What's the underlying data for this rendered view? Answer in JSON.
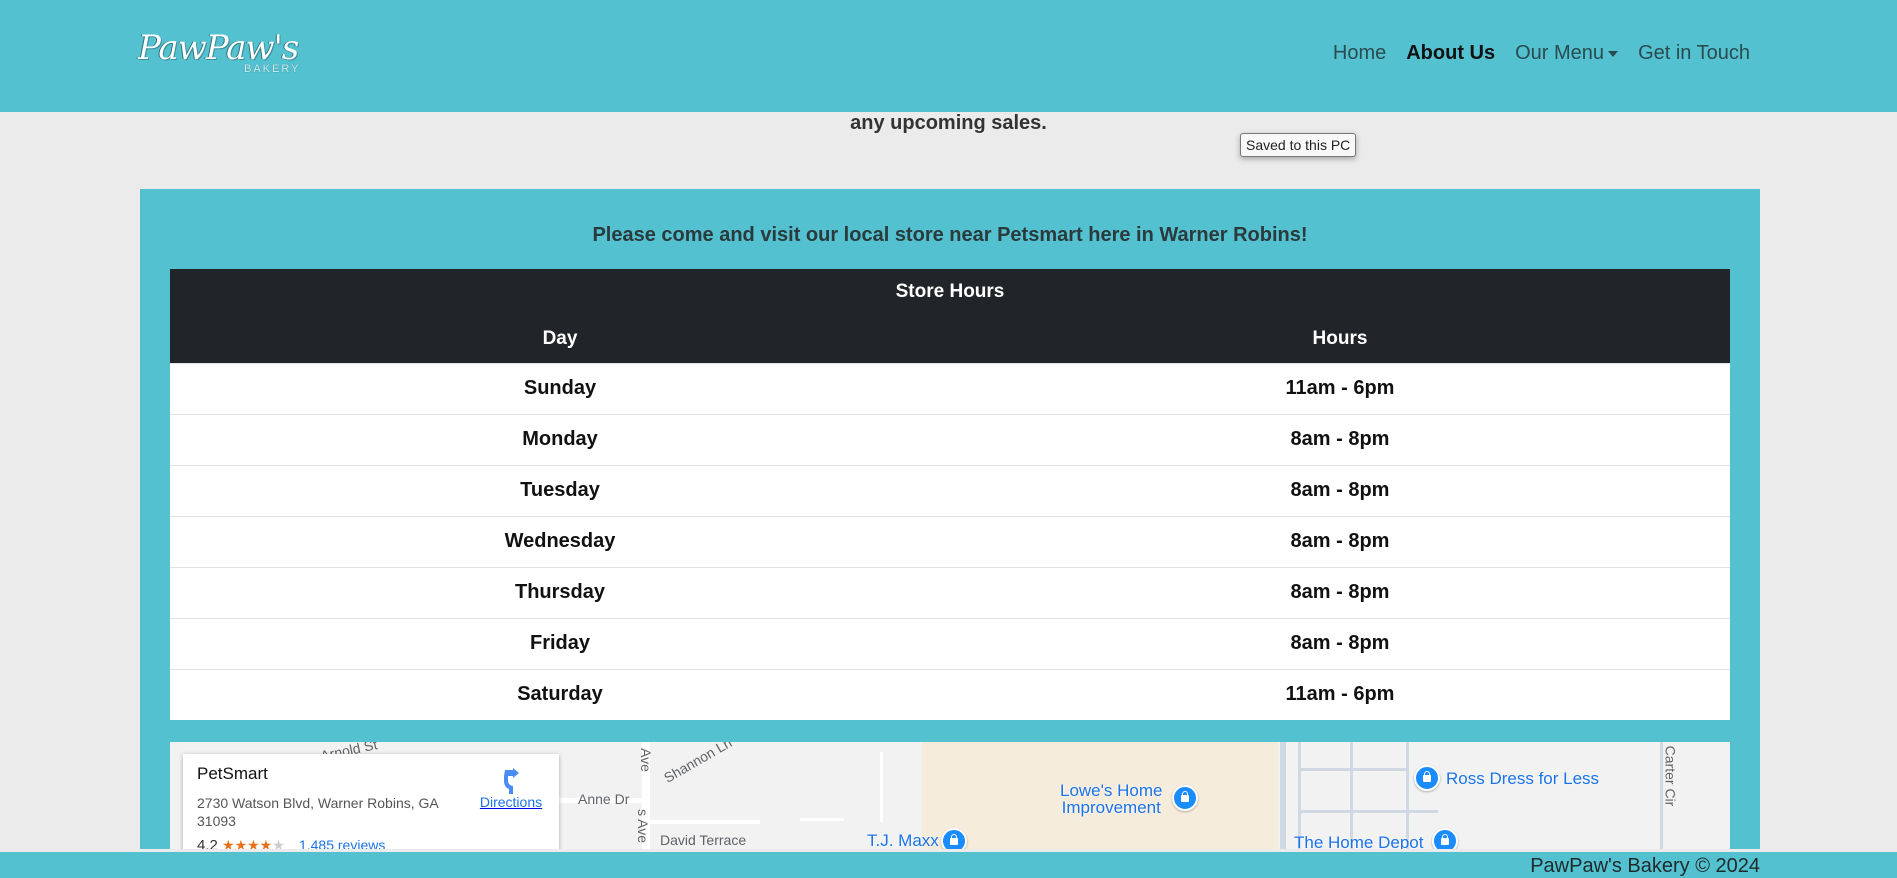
{
  "brand": {
    "logo_text": "PawPaw's",
    "logo_subtext": "BAKERY"
  },
  "nav": {
    "home": "Home",
    "about": "About Us",
    "menu": "Our Menu",
    "contact": "Get in Touch"
  },
  "intro": {
    "upcoming_text": "any upcoming sales."
  },
  "tooltip": {
    "text": "Saved to this PC"
  },
  "store": {
    "visit_text": "Please come and visit our local store near Petsmart here in Warner Robins!",
    "table_title": "Store Hours",
    "col_day": "Day",
    "col_hours": "Hours",
    "rows": [
      {
        "day": "Sunday",
        "hours": "11am - 6pm"
      },
      {
        "day": "Monday",
        "hours": "8am - 8pm"
      },
      {
        "day": "Tuesday",
        "hours": "8am - 8pm"
      },
      {
        "day": "Wednesday",
        "hours": "8am - 8pm"
      },
      {
        "day": "Thursday",
        "hours": "8am - 8pm"
      },
      {
        "day": "Friday",
        "hours": "8am - 8pm"
      },
      {
        "day": "Saturday",
        "hours": "11am - 6pm"
      }
    ]
  },
  "map": {
    "place_name": "PetSmart",
    "address": "2730 Watson Blvd, Warner Robins, GA 31093",
    "rating": "4.2",
    "stars_filled": 4,
    "reviews": "1,485 reviews",
    "directions": "Directions",
    "streets": {
      "arnold": "Arnold St",
      "shannon": "Shannon Ln",
      "anne": "Anne Dr",
      "david": "David Terrace",
      "ave1": "Ave",
      "ave2": "s Ave",
      "carter": "Carter Cir"
    },
    "places": {
      "lowes_line1": "Lowe's Home",
      "lowes_line2": "Improvement",
      "tjmaxx": "T.J. Maxx",
      "ross": "Ross Dress for Less",
      "homedepot": "The Home Depot"
    }
  },
  "footer": {
    "text": "PawPaw's Bakery © 2024"
  }
}
